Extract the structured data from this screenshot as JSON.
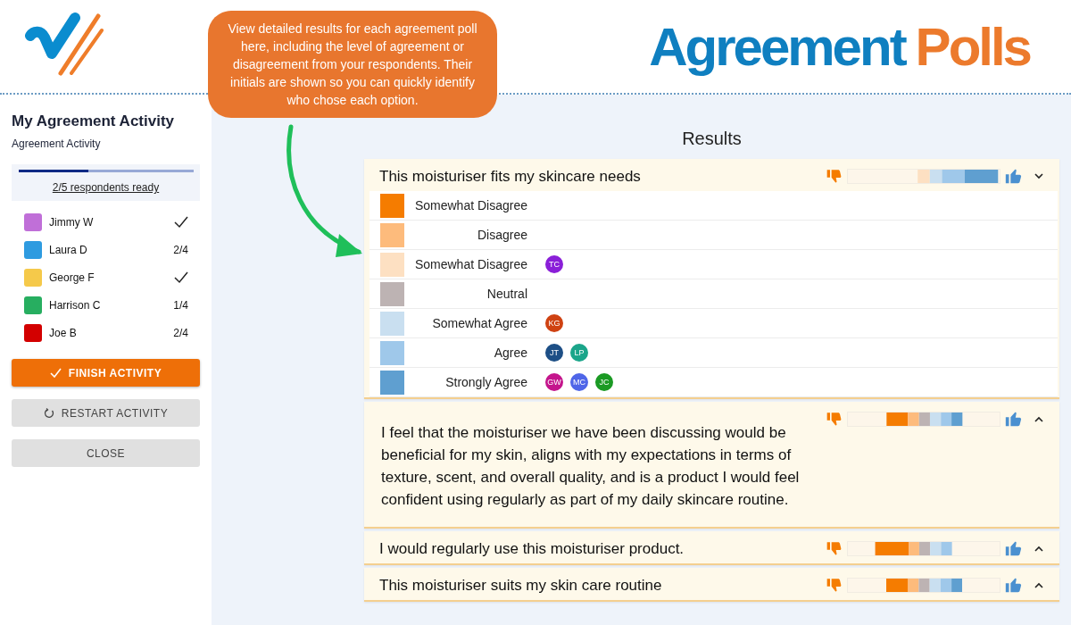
{
  "header": {
    "title_main": "Agreement",
    "title_accent": "Polls"
  },
  "callout": {
    "text": "View detailed results for each agreement poll here, including the level of agreement or disagreement from your respondents. Their initials are shown so you can quickly identify who chose each option."
  },
  "sidebar": {
    "title": "My Agreement Activity",
    "subtitle": "Agreement Activity",
    "progress": {
      "level": 0.4,
      "label": "2/5 respondents ready"
    },
    "participants": [
      {
        "name": "Jimmy W",
        "color": "#c06fd8",
        "kind": "done"
      },
      {
        "name": "Laura D",
        "color": "#2e9be0",
        "kind": "progress",
        "status": "2/4"
      },
      {
        "name": "George F",
        "color": "#f5c94a",
        "kind": "done"
      },
      {
        "name": "Harrison C",
        "color": "#27ae60",
        "kind": "progress",
        "status": "1/4"
      },
      {
        "name": "Joe B",
        "color": "#d30000",
        "kind": "progress",
        "status": "2/4"
      }
    ],
    "buttons": [
      {
        "label": "FINISH ACTIVITY",
        "kind": "primary"
      },
      {
        "label": "RESTART ACTIVITY",
        "kind": "restart"
      },
      {
        "label": "CLOSE",
        "kind": "plain"
      }
    ]
  },
  "results": {
    "heading": "Results",
    "polls": [
      {
        "question": "This moisturiser fits my skincare needs",
        "expanded": true,
        "options": [
          {
            "label": "Somewhat Disagree",
            "color": "#f57c00"
          },
          {
            "label": "Disagree",
            "color": "#fdbb7c"
          },
          {
            "label": "Somewhat Disagree",
            "color": "#fde0c2",
            "respondents": [
              {
                "initials": "TC",
                "color": "#8a1fd8"
              }
            ]
          },
          {
            "label": "Neutral",
            "color": "#bdb3b3"
          },
          {
            "label": "Somewhat Agree",
            "color": "#c9dff0",
            "respondents": [
              {
                "initials": "KG",
                "color": "#cf4212"
              }
            ]
          },
          {
            "label": "Agree",
            "color": "#9fc8ea",
            "respondents": [
              {
                "initials": "JT",
                "color": "#1d4f86"
              },
              {
                "initials": "LP",
                "color": "#1ba58a"
              }
            ]
          },
          {
            "label": "Strongly Agree",
            "color": "#5f9fd0",
            "respondents": [
              {
                "initials": "GW",
                "color": "#c4158c"
              },
              {
                "initials": "MC",
                "color": "#4f66e8"
              },
              {
                "initials": "JC",
                "color": "#1b9a24"
              }
            ]
          }
        ]
      },
      {
        "question": "I feel that the moisturiser we have been discussing would be beneficial for my skin, aligns with my expectations in terms of texture, scent, and overall quality, and is a product I would feel confident using regularly as part of my daily skincare routine.",
        "expanded": false
      },
      {
        "question": "I would regularly use this moisturiser product.",
        "expanded": false
      },
      {
        "question": "This moisturiser suits my skin care routine",
        "expanded": false
      }
    ]
  }
}
